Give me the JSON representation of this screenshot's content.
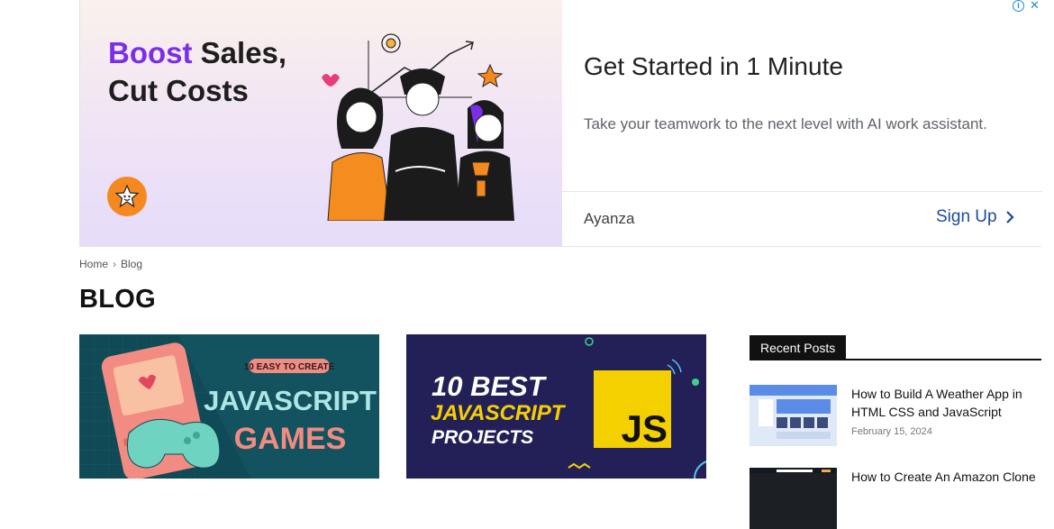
{
  "ad": {
    "headline_part1": "Boost",
    "headline_part2": " Sales,",
    "headline_line2": "Cut Costs",
    "title": "Get Started in 1 Minute",
    "description": "Take your teamwork to the next level with AI work assistant.",
    "advertiser": "Ayanza",
    "cta": "Sign Up",
    "accent_color": "#7b2ee8",
    "cta_color": "#1a4b9b",
    "adchoices_icon": "info-icon",
    "adchoices_close": "✕"
  },
  "breadcrumb": {
    "home": "Home",
    "separator": "›",
    "current": "Blog"
  },
  "page": {
    "title": "BLOG"
  },
  "posts": [
    {
      "badge": "10 EASY TO CREATE",
      "line1": "JAVASCRIPT",
      "line2": "GAMES"
    },
    {
      "line1": "10 BEST",
      "line2": "JAVASCRIPT",
      "line3": "PROJECTS",
      "logo": "JS"
    }
  ],
  "sidebar": {
    "heading": "Recent Posts",
    "items": [
      {
        "title": "How to Build A Weather App in HTML CSS and JavaScript",
        "date": "February 15, 2024"
      },
      {
        "title": "How to Create An Amazon Clone"
      }
    ]
  }
}
